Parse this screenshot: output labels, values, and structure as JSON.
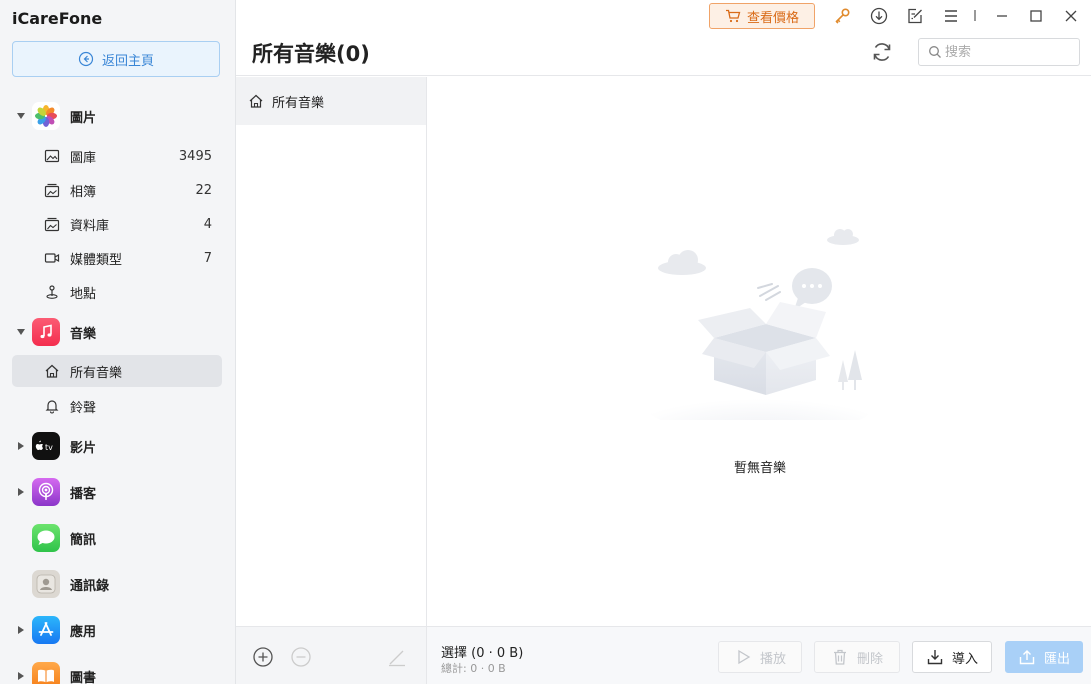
{
  "app": {
    "title": "iCareFone"
  },
  "sidebar": {
    "home_button": "返回主頁",
    "categories": [
      {
        "label": "圖片",
        "expanded": true,
        "items": [
          {
            "label": "圖庫",
            "count": "3495"
          },
          {
            "label": "相簿",
            "count": "22"
          },
          {
            "label": "資料庫",
            "count": "4"
          },
          {
            "label": "媒體類型",
            "count": "7"
          },
          {
            "label": "地點",
            "count": ""
          }
        ]
      },
      {
        "label": "音樂",
        "expanded": true,
        "items": [
          {
            "label": "所有音樂",
            "active": true
          },
          {
            "label": "鈴聲"
          }
        ]
      },
      {
        "label": "影片",
        "expanded": false
      },
      {
        "label": "播客",
        "expanded": false
      },
      {
        "label": "簡訊"
      },
      {
        "label": "通訊錄"
      },
      {
        "label": "應用",
        "expanded": false
      },
      {
        "label": "圖書",
        "expanded": false
      }
    ]
  },
  "header": {
    "title": "所有音樂(0)",
    "price_button": "查看價格",
    "search_placeholder": "搜索"
  },
  "list": {
    "items": [
      {
        "label": "所有音樂"
      }
    ]
  },
  "main": {
    "empty_text": "暫無音樂"
  },
  "footer": {
    "selection": "選擇 (0 · 0 B)",
    "total": "總計: 0 · 0 B",
    "play": "播放",
    "delete": "刪除",
    "import": "導入",
    "export": "匯出"
  },
  "colors": {
    "accent": "#3a86d6",
    "price": "#d96a17",
    "export_bg": "#a9d0f7"
  }
}
